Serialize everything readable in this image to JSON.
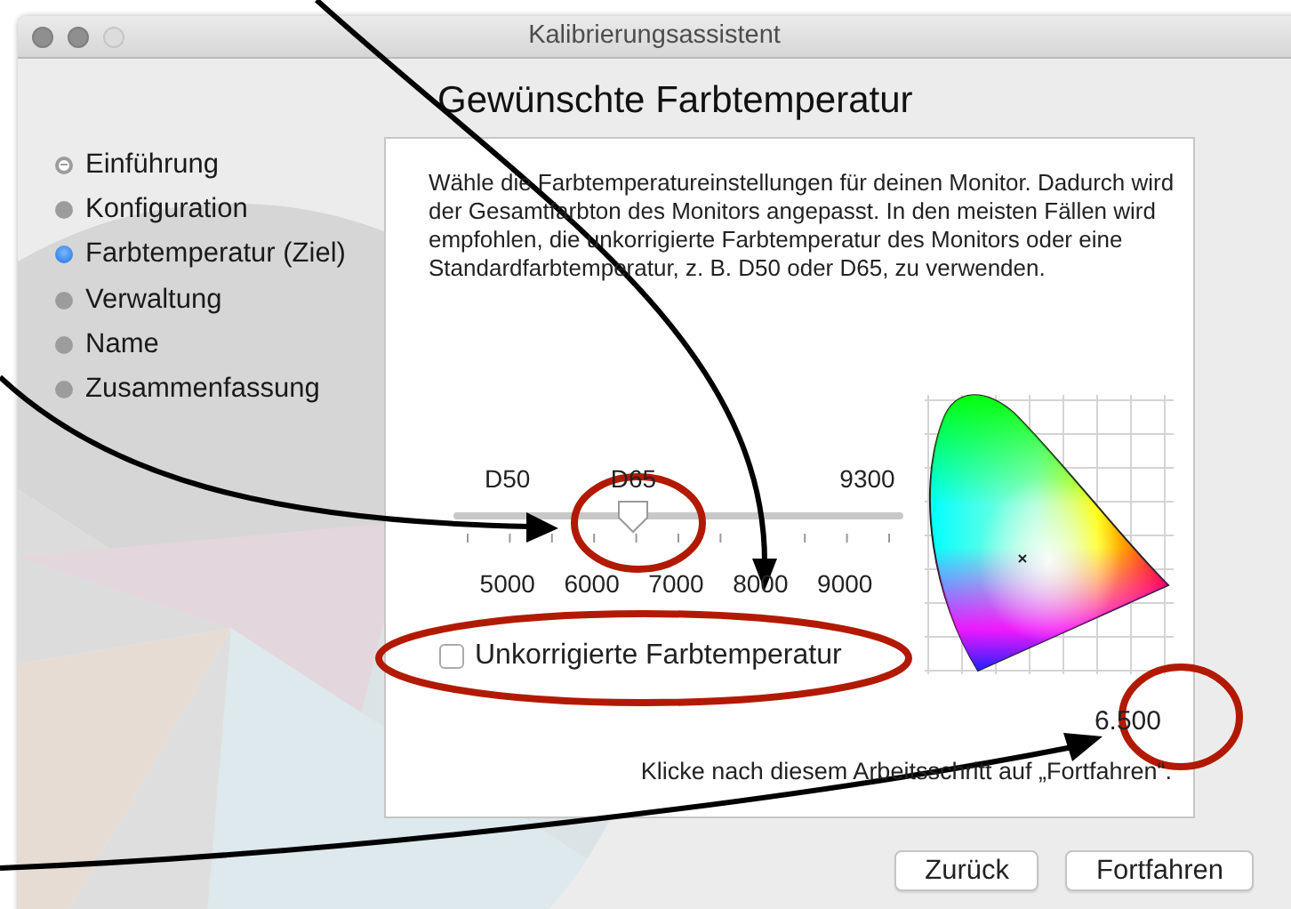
{
  "window": {
    "title": "Kalibrierungsassistent"
  },
  "heading": "Gewünschte Farbtemperatur",
  "steps": [
    {
      "label": "Einführung",
      "selected": false,
      "done": true
    },
    {
      "label": "Konfiguration",
      "selected": false,
      "done": false
    },
    {
      "label": "Farbtemperatur (Ziel)",
      "selected": true,
      "done": false
    },
    {
      "label": "Verwaltung",
      "selected": false,
      "done": false
    },
    {
      "label": "Name",
      "selected": false,
      "done": false
    },
    {
      "label": "Zusammenfassung",
      "selected": false,
      "done": false
    }
  ],
  "description": "Wähle die Farbtemperatureinstellungen für deinen Monitor. Dadurch wird der Gesamtfarbton des Monitors angepasst. In den meisten Fällen wird empfohlen, die unkorrigierte Farbtemperatur des Monitors oder eine Standardfarbtemperatur, z. B. D50 oder D65, zu verwenden.",
  "slider": {
    "top_labels": [
      "D50",
      "D65",
      "9300"
    ],
    "scale_labels": [
      "5000",
      "6000",
      "7000",
      "8000",
      "9000"
    ],
    "level": 0.4
  },
  "checkbox": {
    "label": "Unkorrigierte Farbtemperatur",
    "checked": false
  },
  "value": "6.500",
  "hint": "Klicke nach diesem Arbeitsschritt auf „Fortfahren“.",
  "buttons": [
    "Zurück",
    "Fortfahren"
  ]
}
